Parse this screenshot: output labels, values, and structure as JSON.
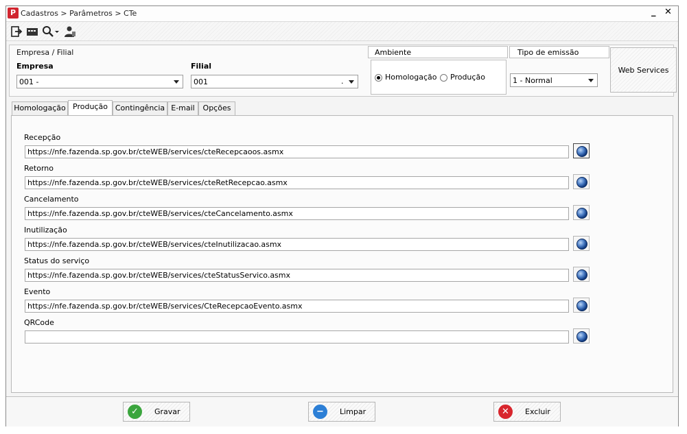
{
  "window": {
    "title": "Cadastros > Parâmetros > CTe",
    "app_icon": "P",
    "minimize": "_",
    "close": "✕"
  },
  "toolbar": {
    "icons": [
      "exit-icon",
      "card-icon",
      "search-icon",
      "user-icon"
    ]
  },
  "header": {
    "empresa_filial_title": "Empresa / Filial",
    "empresa_label": "Empresa",
    "empresa_value": "001 -",
    "filial_label": "Filial",
    "filial_value": "001",
    "filial_suffix": ".",
    "ambiente_title": "Ambiente",
    "ambiente_options": [
      "Homologação",
      "Produção"
    ],
    "ambiente_selected": "Homologação",
    "tipo_emissao_title": "Tipo de emissão",
    "tipo_emissao_value": "1 - Normal",
    "web_services_label": "Web Services"
  },
  "tabs": [
    "Homologação",
    "Produção",
    "Contingência",
    "E-mail",
    "Opções"
  ],
  "active_tab": "Produção",
  "services": [
    {
      "label": "Recepção",
      "url": "https://nfe.fazenda.sp.gov.br/cteWEB/services/cteRecepcaoos.asmx"
    },
    {
      "label": "Retorno",
      "url": "https://nfe.fazenda.sp.gov.br/cteWEB/services/cteRetRecepcao.asmx"
    },
    {
      "label": "Cancelamento",
      "url": "https://nfe.fazenda.sp.gov.br/cteWEB/services/cteCancelamento.asmx"
    },
    {
      "label": "Inutilização",
      "url": "https://nfe.fazenda.sp.gov.br/cteWEB/services/cteInutilizacao.asmx"
    },
    {
      "label": "Status do serviço",
      "url": "https://nfe.fazenda.sp.gov.br/cteWEB/services/cteStatusServico.asmx"
    },
    {
      "label": "Evento",
      "url": "https://nfe.fazenda.sp.gov.br/cteWEB/services/CteRecepcaoEvento.asmx"
    },
    {
      "label": "QRCode",
      "url": ""
    }
  ],
  "footer": {
    "save": "Gravar",
    "clear": "Limpar",
    "delete": "Excluir"
  },
  "colors": {
    "save": "#3aa53d",
    "clear": "#2c7fd6",
    "delete": "#d8262d",
    "brand": "#d1252f"
  }
}
